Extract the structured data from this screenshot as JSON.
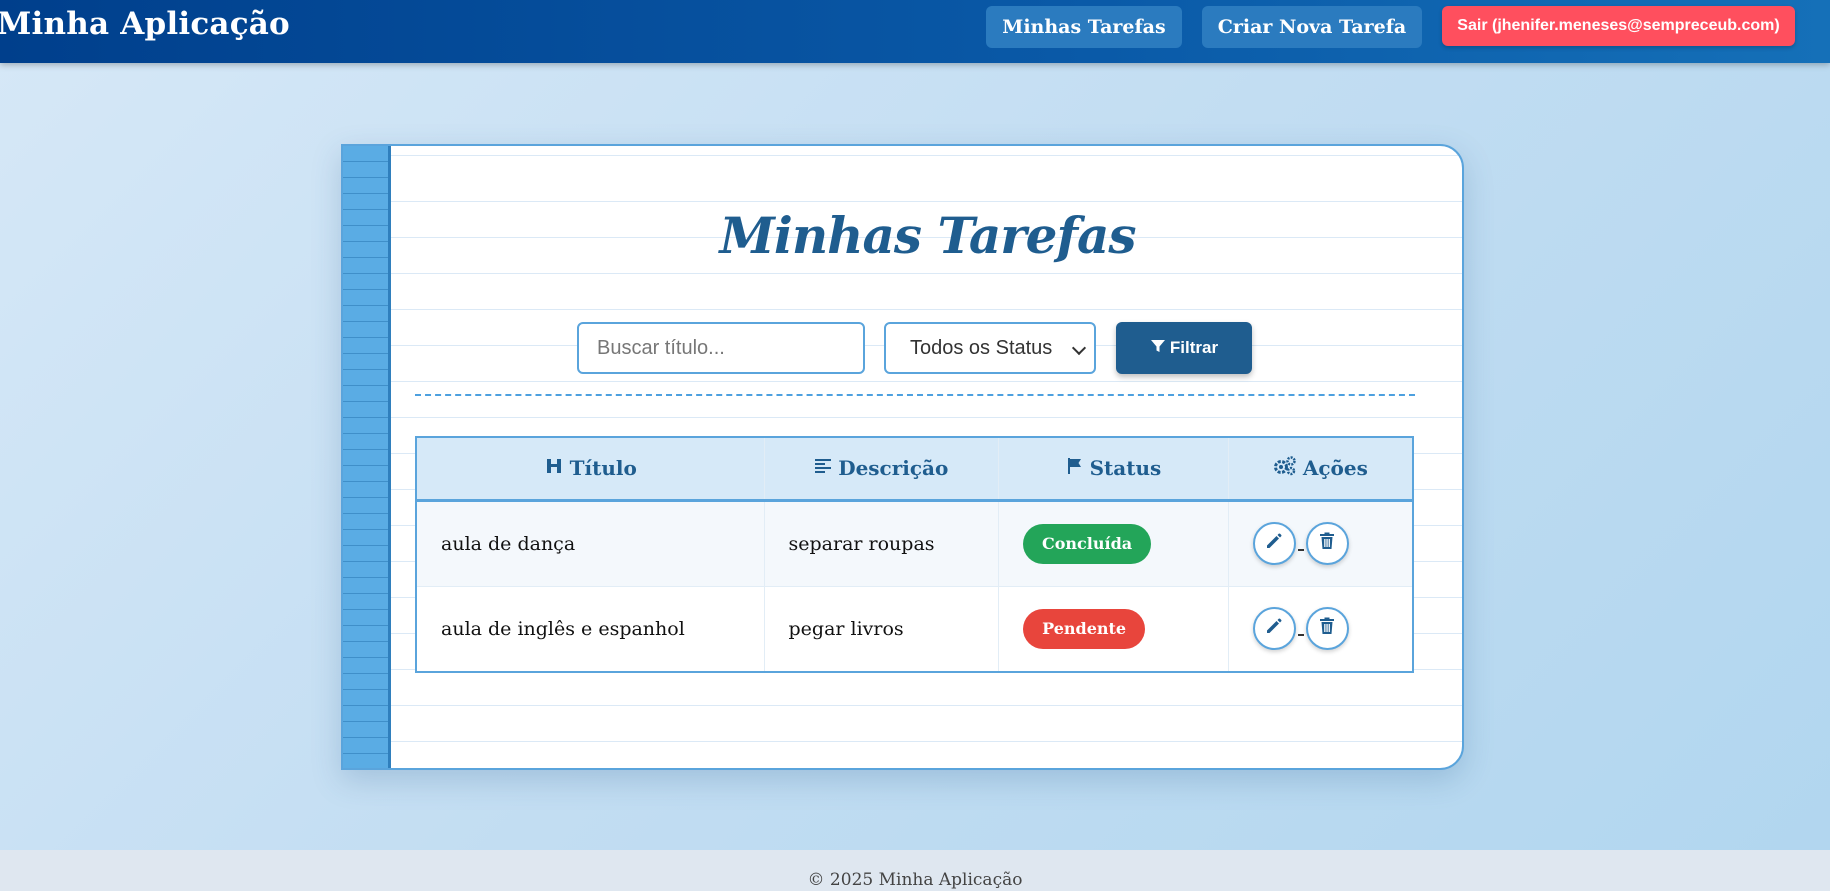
{
  "header": {
    "brand": "Minha Aplicação",
    "nav_tasks": "Minhas Tarefas",
    "nav_new": "Criar Nova Tarefa",
    "logout": "Sair (jhenifer.meneses@sempreceub.com)"
  },
  "main": {
    "title": "Minhas Tarefas",
    "search_placeholder": "Buscar título...",
    "status_filter": "Todos os Status",
    "filter_button": "Filtrar"
  },
  "table": {
    "headers": {
      "title": "Título",
      "description": "Descrição",
      "status": "Status",
      "actions": "Ações"
    },
    "rows": [
      {
        "title": "aula de dança",
        "description": "separar roupas",
        "status": "Concluída"
      },
      {
        "title": "aula de inglês e espanhol",
        "description": "pegar livros",
        "status": "Pendente"
      }
    ]
  },
  "colors": {
    "header_blue": "#0a5aa8",
    "accent": "#1f5d8f",
    "done": "#23a559",
    "pending": "#e8453c",
    "logout": "#ff4f5e"
  },
  "icons": {
    "title_header": "heading-icon",
    "description_header": "align-left-icon",
    "status_header": "flag-icon",
    "actions_header": "gears-icon",
    "filter": "filter-icon",
    "edit": "pencil-icon",
    "delete": "trash-icon"
  },
  "footer": {
    "text": "© 2025 Minha Aplicação"
  }
}
